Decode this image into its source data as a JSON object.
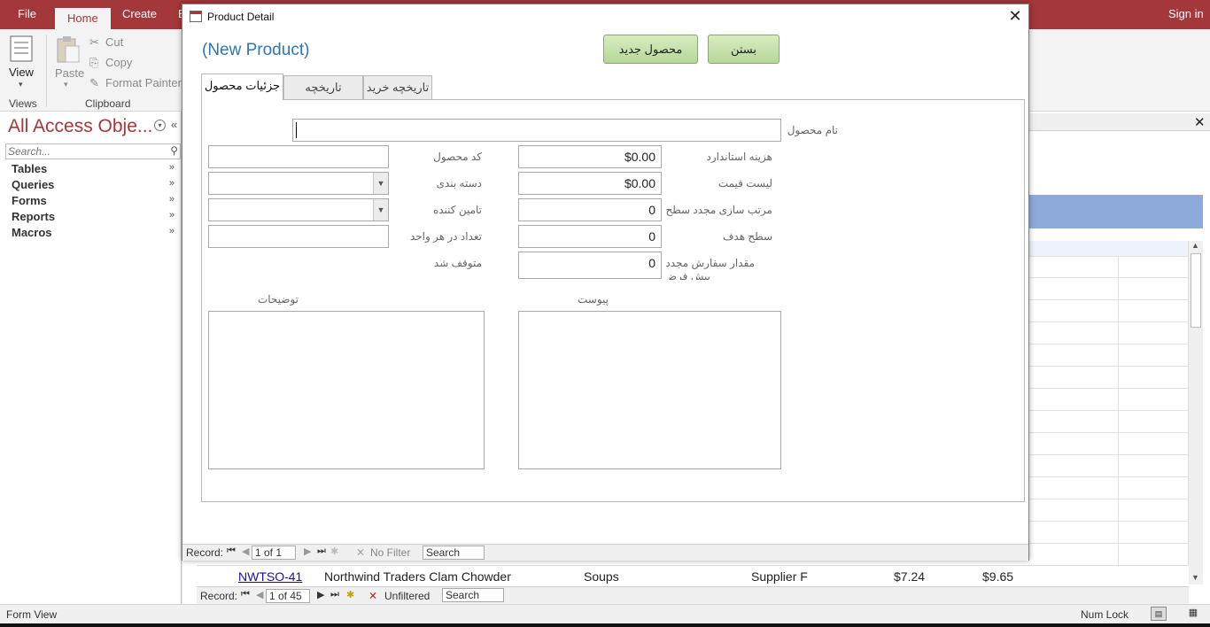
{
  "ribbon": {
    "tabs": [
      "File",
      "Home",
      "Create",
      "E"
    ],
    "sign_in": "Sign in",
    "view_label": "View",
    "paste_label": "Paste",
    "cut_label": "Cut",
    "copy_label": "Copy",
    "format_painter_label": "Format Painter",
    "groups": {
      "views": "Views",
      "clipboard": "Clipboard"
    }
  },
  "nav_pane": {
    "title": "All Access Obje...",
    "search_placeholder": "Search...",
    "items": [
      {
        "label": "Tables"
      },
      {
        "label": "Queries"
      },
      {
        "label": "Forms"
      },
      {
        "label": "Reports"
      },
      {
        "label": "Macros"
      }
    ]
  },
  "background_table": {
    "row": {
      "id": "NWTSO-41",
      "name": "Northwind Traders Clam Chowder",
      "category": "Soups",
      "supplier": "Supplier F",
      "cost": "$7.24",
      "price": "$9.65"
    },
    "record_label": "Record:",
    "record_position": "1 of 45",
    "filter_label": "Unfiltered",
    "search_label": "Search"
  },
  "status_bar": {
    "left": "Form View",
    "num_lock": "Num Lock"
  },
  "dialog": {
    "title": "Product Detail",
    "heading": "(New Product)",
    "new_product_button": "محصول جدید",
    "close_button": "بستن",
    "tabs": [
      {
        "label": "جزئیات محصول",
        "active": true
      },
      {
        "label": "تاریخچه سفارش",
        "active": false
      },
      {
        "label": "تاریخچه خرید",
        "active": false
      }
    ],
    "fields": {
      "product_name": {
        "label": "نام محصول",
        "value": ""
      },
      "standard_cost": {
        "label": "هزینه استاندارد",
        "value": "$0.00"
      },
      "list_price": {
        "label": "لیست قیمت",
        "value": "$0.00"
      },
      "reorder_level": {
        "label": "مرتب سازی مجدد سطح",
        "value": "0"
      },
      "target_level": {
        "label": "سطح هدف",
        "value": "0"
      },
      "reorder_qty": {
        "label": "مقدار سفارش مجدد",
        "label2": "پیش فرض",
        "value": "0"
      },
      "product_code": {
        "label": "کد محصول",
        "value": ""
      },
      "category": {
        "label": "دسته بندی",
        "value": ""
      },
      "supplier": {
        "label": "تامین کننده",
        "value": ""
      },
      "qty_per_unit": {
        "label": "تعداد در هر واحد",
        "value": ""
      },
      "discontinued": {
        "label": "متوقف شد"
      },
      "attachment": {
        "label": "پیوست"
      },
      "description": {
        "label": "توضیحات"
      }
    },
    "nav": {
      "record_label": "Record:",
      "record_position": "1 of 1",
      "filter_label": "No Filter",
      "search_label": "Search"
    }
  }
}
